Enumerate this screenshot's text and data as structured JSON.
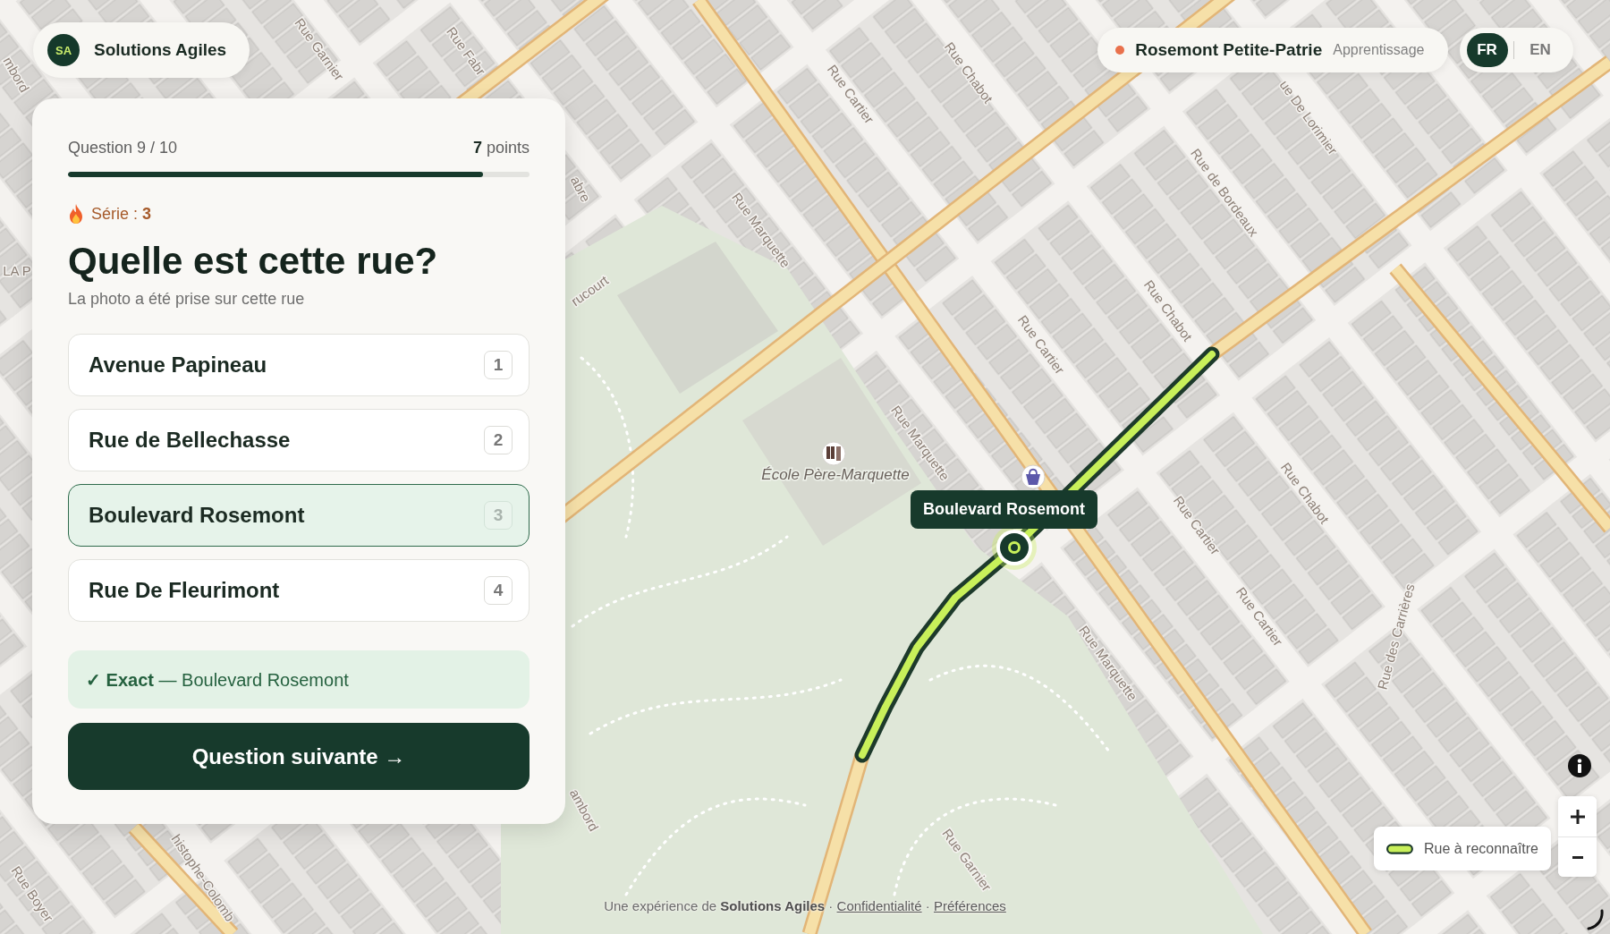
{
  "brand": {
    "initials": "SA",
    "name": "Solutions Agiles"
  },
  "quiz": {
    "progress_label": "Question 9 / 10",
    "score": "**7** points",
    "level": 0.9,
    "streak": "Série : **3**",
    "title": "Quelle est cette rue?",
    "subtitle": "La photo a été prise sur cette rue",
    "options": [
      {
        "label": "Avenue Papineau",
        "key": "1",
        "selected": false
      },
      {
        "label": "Rue de Bellechasse",
        "key": "2",
        "selected": false
      },
      {
        "label": "Boulevard Rosemont",
        "key": "3",
        "selected": true
      },
      {
        "label": "Rue De Fleurimont",
        "key": "4",
        "selected": false
      }
    ],
    "feedback": {
      "text": "**✓ Exact** — Boulevard Rosemont",
      "correct": true
    },
    "next_button": "Question suivante →"
  },
  "area": {
    "name": "Rosemont Petite-Patrie",
    "mode": "Apprentissage"
  },
  "languages": [
    {
      "label": "FR",
      "selected": true
    },
    {
      "label": "EN",
      "selected": false
    }
  ],
  "map": {
    "street_labels": [
      "mbord",
      "Rue Garnier",
      "Rue Fabr",
      "Rue Chabot",
      "Rue Cartier",
      "ue De Lorimier",
      "Rue de Bordeaux",
      "abre",
      "Rue Marquette",
      "rucourt",
      "LA P",
      "Rue Cartier",
      "Rue Chabot",
      "Rue Marquette",
      "Rue Chabot",
      "Rue Cartier",
      "Rue Cartier",
      "Rue des Carrières",
      "Rue Marquette",
      "ambord",
      "Rue Garnier",
      "histophe-Colomb",
      "Rue Boyer"
    ],
    "place_label": "École Père-Marquette",
    "route_tooltip": "Boulevard Rosemont"
  },
  "legend": {
    "label": "Rue à reconnaître"
  },
  "footer": {
    "parts": [
      {
        "kind": "text",
        "text": "Une expérience de **Solutions Agiles** ·"
      },
      {
        "kind": "link",
        "text": "Confidentialité"
      },
      {
        "kind": "text",
        "text": "·"
      },
      {
        "kind": "link",
        "text": "Préférences"
      }
    ]
  }
}
